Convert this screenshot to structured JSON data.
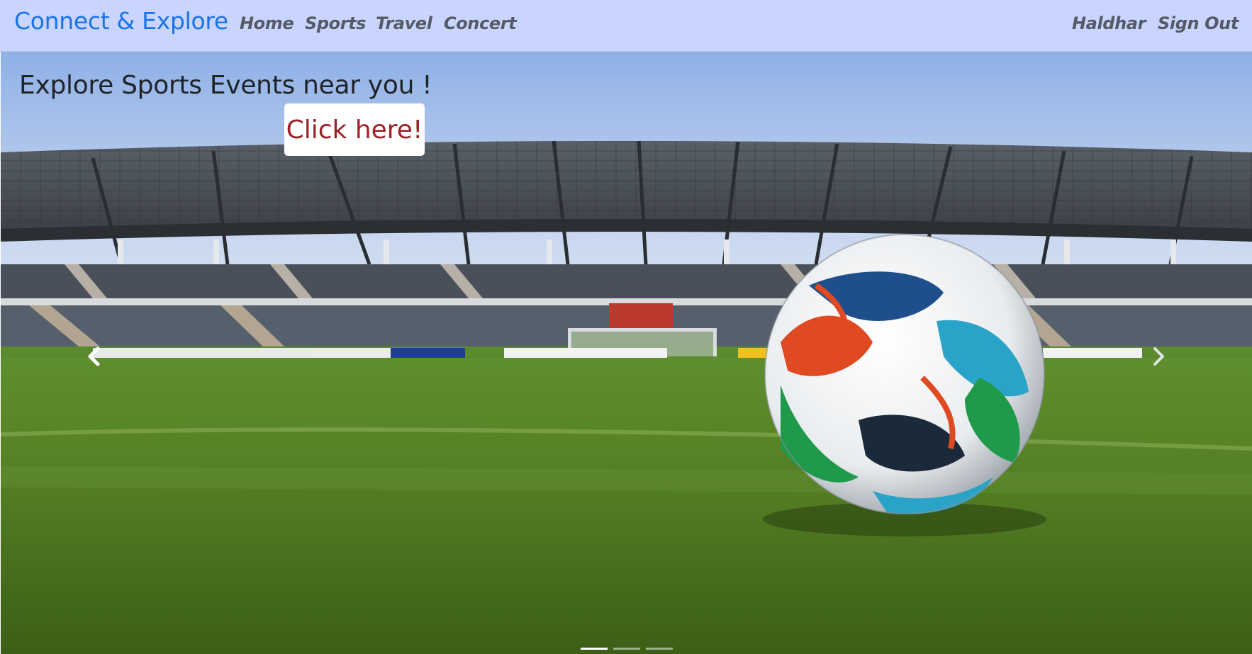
{
  "navbar": {
    "brand": "Connect & Explore",
    "links": [
      "Home",
      "Sports",
      "Travel",
      "Concert"
    ],
    "user_name": "Haldhar",
    "sign_out": "Sign Out"
  },
  "carousel": {
    "title": "Explore Sports Events near you !",
    "cta_label": "Click here!",
    "prev_icon": "chevron-left-icon",
    "next_icon": "chevron-right-icon",
    "slide_count": 3,
    "active_slide": 1
  },
  "colors": {
    "navbar_bg": "#cad5ff",
    "brand": "#1a73e8",
    "nav_link": "#545b66",
    "cta_text": "#9b2226"
  }
}
